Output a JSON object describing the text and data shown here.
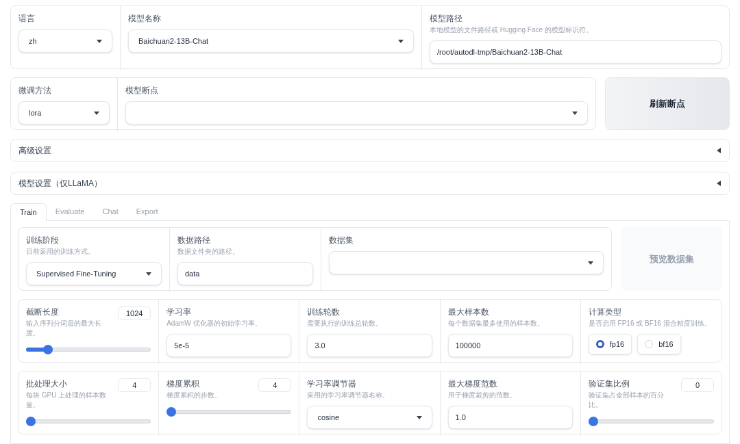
{
  "top_row": [
    {
      "kind": "dropdown",
      "label": "语言",
      "value": "zh"
    },
    {
      "kind": "dropdown",
      "label": "模型名称",
      "value": "Baichuan2-13B-Chat"
    },
    {
      "kind": "textbox",
      "label": "模型路径",
      "info": "本地模型的文件路径或 Hugging Face 的模型标识符。",
      "value": "/root/autodl-tmp/Baichuan2-13B-Chat"
    }
  ],
  "second_row": {
    "fields": [
      {
        "kind": "dropdown",
        "label": "微调方法",
        "value": "lora"
      },
      {
        "kind": "dropdown",
        "label": "模型断点"
      }
    ],
    "button": {
      "label": "刷新断点",
      "disabled": false
    }
  },
  "accordions": [
    {
      "label": "高级设置",
      "expanded": false
    },
    {
      "label": "模型设置（仅LLaMA）",
      "expanded": false
    }
  ],
  "tabs": [
    {
      "label": "Train",
      "selected": true
    },
    {
      "label": "Evaluate",
      "selected": false
    },
    {
      "label": "Chat",
      "selected": false
    },
    {
      "label": "Export",
      "selected": false
    }
  ],
  "train": {
    "data_row": {
      "fields": [
        {
          "kind": "dropdown",
          "label": "训练阶段",
          "info": "目前采用的训练方式。",
          "value": "Supervised Fine-Tuning"
        },
        {
          "kind": "textbox",
          "label": "数据路径",
          "info": "数据文件夹的路径。",
          "value": "data"
        },
        {
          "kind": "dropdown",
          "label": "数据集"
        }
      ],
      "button": {
        "label": "预览数据集",
        "disabled": true
      }
    },
    "param_rows": [
      [
        {
          "kind": "slider",
          "label": "截断长度",
          "info": "输入序列分词后的最大长度。",
          "number": "1024",
          "level": 0.15
        },
        {
          "kind": "textbox",
          "label": "学习率",
          "info": "AdamW 优化器的初始学习率。",
          "value": "5e-5"
        },
        {
          "kind": "textbox",
          "label": "训练轮数",
          "info": "需要执行的训练总轮数。",
          "value": "3.0"
        },
        {
          "kind": "textbox",
          "label": "最大样本数",
          "info": "每个数据集最多使用的样本数。",
          "value": "100000"
        },
        {
          "kind": "radio",
          "label": "计算类型",
          "info": "是否启用 FP16 或 BF16 混合精度训练。",
          "options": [
            {
              "label": "fp16",
              "selected": true
            },
            {
              "label": "bf16",
              "selected": false
            }
          ]
        }
      ],
      [
        {
          "kind": "slider",
          "label": "批处理大小",
          "info": "每块 GPU 上处理的样本数量。",
          "number": "4",
          "level": 0
        },
        {
          "kind": "slider",
          "label": "梯度累积",
          "info": "梯度累积的步数。",
          "number": "4",
          "level": 0
        },
        {
          "kind": "dropdown",
          "label": "学习率调节器",
          "info": "采用的学习率调节器名称。",
          "value": "cosine"
        },
        {
          "kind": "textbox",
          "label": "最大梯度范数",
          "info": "用于梯度裁剪的范数。",
          "value": "1.0"
        },
        {
          "kind": "slider",
          "label": "验证集比例",
          "info": "验证集占全部样本的百分比。",
          "number": "0",
          "level": 0
        }
      ]
    ]
  }
}
